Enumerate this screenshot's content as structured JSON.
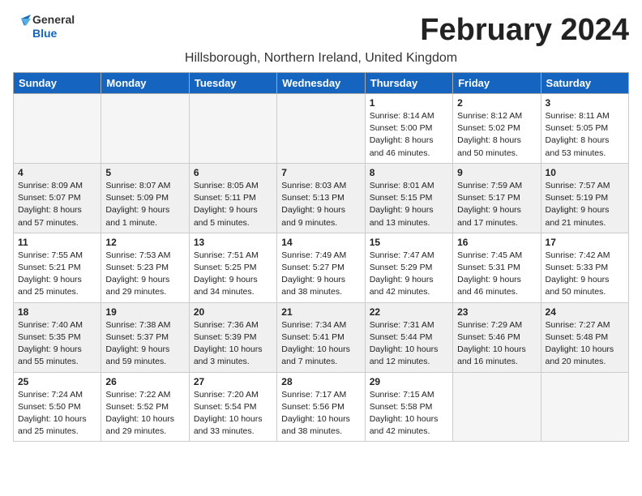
{
  "logo": {
    "general": "General",
    "blue": "Blue"
  },
  "title": "February 2024",
  "subtitle": "Hillsborough, Northern Ireland, United Kingdom",
  "days_of_week": [
    "Sunday",
    "Monday",
    "Tuesday",
    "Wednesday",
    "Thursday",
    "Friday",
    "Saturday"
  ],
  "weeks": [
    [
      {
        "day": "",
        "info": ""
      },
      {
        "day": "",
        "info": ""
      },
      {
        "day": "",
        "info": ""
      },
      {
        "day": "",
        "info": ""
      },
      {
        "day": "1",
        "info": "Sunrise: 8:14 AM\nSunset: 5:00 PM\nDaylight: 8 hours\nand 46 minutes."
      },
      {
        "day": "2",
        "info": "Sunrise: 8:12 AM\nSunset: 5:02 PM\nDaylight: 8 hours\nand 50 minutes."
      },
      {
        "day": "3",
        "info": "Sunrise: 8:11 AM\nSunset: 5:05 PM\nDaylight: 8 hours\nand 53 minutes."
      }
    ],
    [
      {
        "day": "4",
        "info": "Sunrise: 8:09 AM\nSunset: 5:07 PM\nDaylight: 8 hours\nand 57 minutes."
      },
      {
        "day": "5",
        "info": "Sunrise: 8:07 AM\nSunset: 5:09 PM\nDaylight: 9 hours\nand 1 minute."
      },
      {
        "day": "6",
        "info": "Sunrise: 8:05 AM\nSunset: 5:11 PM\nDaylight: 9 hours\nand 5 minutes."
      },
      {
        "day": "7",
        "info": "Sunrise: 8:03 AM\nSunset: 5:13 PM\nDaylight: 9 hours\nand 9 minutes."
      },
      {
        "day": "8",
        "info": "Sunrise: 8:01 AM\nSunset: 5:15 PM\nDaylight: 9 hours\nand 13 minutes."
      },
      {
        "day": "9",
        "info": "Sunrise: 7:59 AM\nSunset: 5:17 PM\nDaylight: 9 hours\nand 17 minutes."
      },
      {
        "day": "10",
        "info": "Sunrise: 7:57 AM\nSunset: 5:19 PM\nDaylight: 9 hours\nand 21 minutes."
      }
    ],
    [
      {
        "day": "11",
        "info": "Sunrise: 7:55 AM\nSunset: 5:21 PM\nDaylight: 9 hours\nand 25 minutes."
      },
      {
        "day": "12",
        "info": "Sunrise: 7:53 AM\nSunset: 5:23 PM\nDaylight: 9 hours\nand 29 minutes."
      },
      {
        "day": "13",
        "info": "Sunrise: 7:51 AM\nSunset: 5:25 PM\nDaylight: 9 hours\nand 34 minutes."
      },
      {
        "day": "14",
        "info": "Sunrise: 7:49 AM\nSunset: 5:27 PM\nDaylight: 9 hours\nand 38 minutes."
      },
      {
        "day": "15",
        "info": "Sunrise: 7:47 AM\nSunset: 5:29 PM\nDaylight: 9 hours\nand 42 minutes."
      },
      {
        "day": "16",
        "info": "Sunrise: 7:45 AM\nSunset: 5:31 PM\nDaylight: 9 hours\nand 46 minutes."
      },
      {
        "day": "17",
        "info": "Sunrise: 7:42 AM\nSunset: 5:33 PM\nDaylight: 9 hours\nand 50 minutes."
      }
    ],
    [
      {
        "day": "18",
        "info": "Sunrise: 7:40 AM\nSunset: 5:35 PM\nDaylight: 9 hours\nand 55 minutes."
      },
      {
        "day": "19",
        "info": "Sunrise: 7:38 AM\nSunset: 5:37 PM\nDaylight: 9 hours\nand 59 minutes."
      },
      {
        "day": "20",
        "info": "Sunrise: 7:36 AM\nSunset: 5:39 PM\nDaylight: 10 hours\nand 3 minutes."
      },
      {
        "day": "21",
        "info": "Sunrise: 7:34 AM\nSunset: 5:41 PM\nDaylight: 10 hours\nand 7 minutes."
      },
      {
        "day": "22",
        "info": "Sunrise: 7:31 AM\nSunset: 5:44 PM\nDaylight: 10 hours\nand 12 minutes."
      },
      {
        "day": "23",
        "info": "Sunrise: 7:29 AM\nSunset: 5:46 PM\nDaylight: 10 hours\nand 16 minutes."
      },
      {
        "day": "24",
        "info": "Sunrise: 7:27 AM\nSunset: 5:48 PM\nDaylight: 10 hours\nand 20 minutes."
      }
    ],
    [
      {
        "day": "25",
        "info": "Sunrise: 7:24 AM\nSunset: 5:50 PM\nDaylight: 10 hours\nand 25 minutes."
      },
      {
        "day": "26",
        "info": "Sunrise: 7:22 AM\nSunset: 5:52 PM\nDaylight: 10 hours\nand 29 minutes."
      },
      {
        "day": "27",
        "info": "Sunrise: 7:20 AM\nSunset: 5:54 PM\nDaylight: 10 hours\nand 33 minutes."
      },
      {
        "day": "28",
        "info": "Sunrise: 7:17 AM\nSunset: 5:56 PM\nDaylight: 10 hours\nand 38 minutes."
      },
      {
        "day": "29",
        "info": "Sunrise: 7:15 AM\nSunset: 5:58 PM\nDaylight: 10 hours\nand 42 minutes."
      },
      {
        "day": "",
        "info": ""
      },
      {
        "day": "",
        "info": ""
      }
    ]
  ]
}
